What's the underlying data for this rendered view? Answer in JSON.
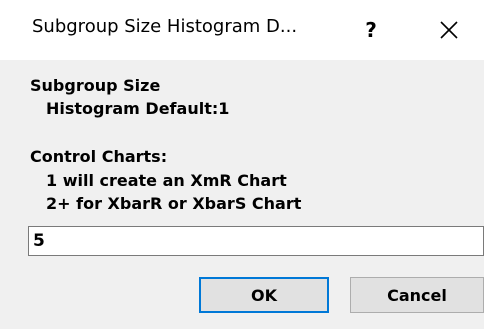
{
  "dialog": {
    "title": "Subgroup Size   Histogram D...",
    "help_label": "?",
    "close_icon": "close-icon"
  },
  "content": {
    "line1": "Subgroup Size",
    "line2": "Histogram Default:1",
    "line3": "Control Charts:",
    "line4": "1 will create an XmR Chart",
    "line5": "2+ for XbarR or XbarS Chart"
  },
  "input": {
    "value": "5"
  },
  "buttons": {
    "ok_label": "OK",
    "cancel_label": "Cancel"
  },
  "colors": {
    "titlebar_bg": "#ffffff",
    "dialog_bg": "#f0f0f0",
    "accent_focus": "#0078d7",
    "button_bg": "#e1e1e1"
  }
}
